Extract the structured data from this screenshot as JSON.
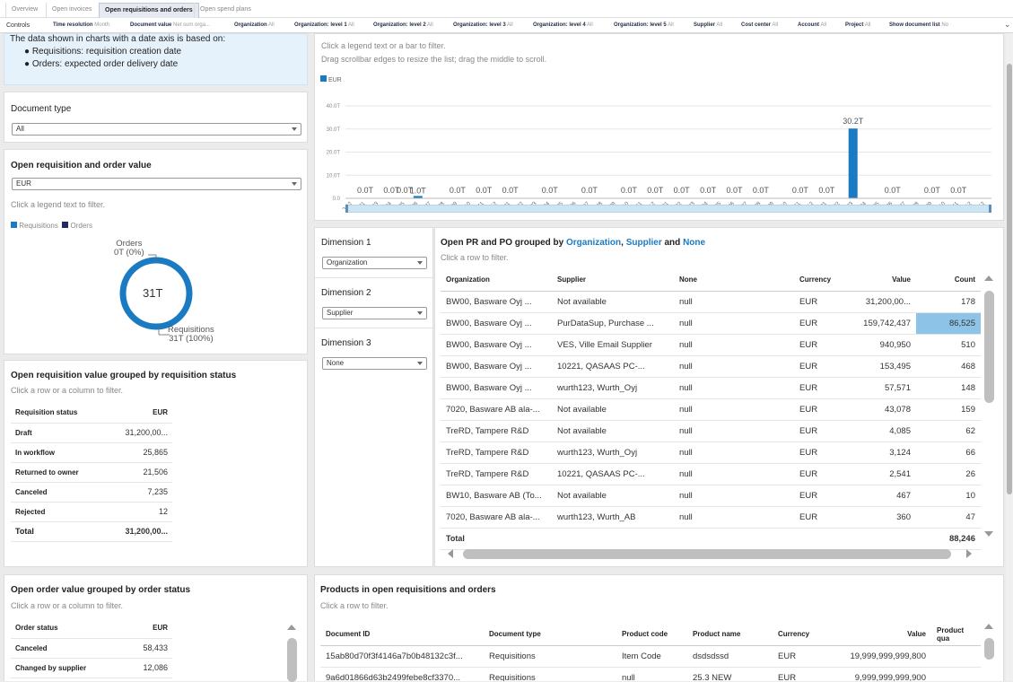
{
  "tabs": [
    {
      "label": "Overview"
    },
    {
      "label": "Open invoices"
    },
    {
      "label": "Open requisitions and orders"
    },
    {
      "label": "Open spend plans"
    }
  ],
  "controls": {
    "label": "Controls",
    "items": [
      {
        "name": "Time resolution",
        "value": "Month"
      },
      {
        "name": "Document value",
        "value": "Net sum orga..."
      },
      {
        "name": "Organization",
        "value": "All"
      },
      {
        "name": "Organization: level 1",
        "value": "All"
      },
      {
        "name": "Organization: level 2",
        "value": "All"
      },
      {
        "name": "Organization: level 3",
        "value": "All"
      },
      {
        "name": "Organization: level 4",
        "value": "All"
      },
      {
        "name": "Organization: level 5",
        "value": "All"
      },
      {
        "name": "Supplier",
        "value": "All"
      },
      {
        "name": "Cost center",
        "value": "All"
      },
      {
        "name": "Account",
        "value": "All"
      },
      {
        "name": "Project",
        "value": "All"
      },
      {
        "name": "Show document list",
        "value": "No"
      }
    ]
  },
  "info": {
    "line1": "The data shown in charts with a date axis is based on:",
    "bullet1": "Requisitions: requisition creation date",
    "bullet2": "Orders: expected order delivery date"
  },
  "doc_type": {
    "title": "Document type",
    "value": "All"
  },
  "donut": {
    "title": "Open requisition and order value",
    "currency": "EUR",
    "hint": "Click a legend text to filter.",
    "legend": [
      "Requisitions",
      "Orders"
    ],
    "center": "31T",
    "orders_label": "Orders",
    "orders_value": "0T (0%)",
    "req_label": "Requisitions",
    "req_value": "31T (100%)",
    "colors": {
      "requisitions": "#1a7bc2",
      "orders": "#1f2a5e"
    }
  },
  "req_status": {
    "title": "Open requisition value grouped by requisition status",
    "hint": "Click a row or a column to filter.",
    "col1": "Requisition status",
    "col2": "EUR",
    "rows": [
      {
        "label": "Draft",
        "value": "31,200,00..."
      },
      {
        "label": "In workflow",
        "value": "25,865"
      },
      {
        "label": "Returned to owner",
        "value": "21,506"
      },
      {
        "label": "Canceled",
        "value": "7,235"
      },
      {
        "label": "Rejected",
        "value": "12"
      }
    ],
    "total_label": "Total",
    "total_value": "31,200,00..."
  },
  "order_status": {
    "title": "Open order value grouped by order status",
    "hint": "Click a row or a column to filter.",
    "col1": "Order status",
    "col2": "EUR",
    "rows": [
      {
        "label": "Canceled",
        "value": "58,433"
      },
      {
        "label": "Changed by supplier",
        "value": "12,086"
      }
    ]
  },
  "bar_panel": {
    "hint1": "Click a legend text or a bar to filter.",
    "hint2": "Drag scrollbar edges to resize the list; drag the middle to scroll.",
    "legend": "EUR"
  },
  "chart_data": {
    "type": "bar",
    "series": [
      {
        "name": "EUR",
        "values": [
          0,
          0,
          0,
          1,
          0,
          0,
          0,
          0,
          0,
          0,
          0,
          0,
          0,
          0,
          0,
          0,
          0,
          0,
          0,
          0,
          0,
          0,
          30.2,
          0,
          0,
          0
        ]
      }
    ],
    "categories": [
      "2020-12",
      "2022-01",
      "2022-03",
      "2022-04",
      "2022-05",
      "2022-06",
      "2022-07",
      "2022-08",
      "2022-09",
      "2022-10",
      "2022-11",
      "2022-12",
      "2023-01",
      "2023-02",
      "2023-03",
      "2023-04",
      "2023-05",
      "2023-06",
      "2023-07",
      "2023-08",
      "2023-09",
      "2023-10",
      "2023-11",
      "2023-12",
      "2024-01",
      "2024-02",
      "2024-03",
      "2024-04",
      "2024-05",
      "2024-06",
      "2024-07",
      "2024-08",
      "2024-09",
      "2024-10",
      "2024-11",
      "2024-12",
      "2025-01",
      "2025-02",
      "2025-03",
      "2025-04",
      "2025-05",
      "2025-06",
      "2025-07",
      "2025-08",
      "2025-09",
      "2025-10",
      "2025-11",
      "2025-12",
      "2033-12"
    ],
    "bar_values": [
      0,
      0,
      0,
      0,
      0,
      1.0,
      0,
      0,
      0,
      0,
      0,
      0,
      0,
      0,
      0,
      0,
      0,
      0,
      0,
      0,
      0,
      0,
      0,
      0,
      0,
      0,
      0,
      0,
      0,
      0,
      0,
      0,
      0,
      0,
      0,
      0,
      0,
      0,
      30.2,
      0,
      0,
      0,
      0,
      0,
      0,
      0,
      0,
      0,
      0
    ],
    "value_labels": [
      {
        "i": 1,
        "t": "0.0T"
      },
      {
        "i": 3,
        "t": "0.0T"
      },
      {
        "i": 4,
        "t": "0.0T"
      },
      {
        "i": 5,
        "t": "1.0T"
      },
      {
        "i": 8,
        "t": "0.0T"
      },
      {
        "i": 10,
        "t": "0.0T"
      },
      {
        "i": 12,
        "t": "0.0T"
      },
      {
        "i": 15,
        "t": "0.0T"
      },
      {
        "i": 18,
        "t": "0.0T"
      },
      {
        "i": 21,
        "t": "0.0T"
      },
      {
        "i": 23,
        "t": "0.0T"
      },
      {
        "i": 25,
        "t": "0.0T"
      },
      {
        "i": 27,
        "t": "0.0T"
      },
      {
        "i": 29,
        "t": "0.0T"
      },
      {
        "i": 31,
        "t": "0.0T"
      },
      {
        "i": 34,
        "t": "0.0T"
      },
      {
        "i": 36,
        "t": "0.0T"
      },
      {
        "i": 38,
        "t": "30.2T"
      },
      {
        "i": 41,
        "t": "0.0T"
      },
      {
        "i": 44,
        "t": "0.0T"
      },
      {
        "i": 46,
        "t": "0.0T"
      }
    ],
    "yticks": [
      "0.0",
      "10.0T",
      "20.0T",
      "30.0T",
      "40.0T"
    ],
    "ylim": [
      0,
      40
    ],
    "color": "#1a7bc2"
  },
  "dims": {
    "d1": "Dimension 1",
    "d1v": "Organization",
    "d2": "Dimension 2",
    "d2v": "Supplier",
    "d3": "Dimension 3",
    "d3v": "None"
  },
  "grid": {
    "title_pre": "Open PR and PO grouped by ",
    "t1": "Organization",
    "sep1": ", ",
    "t2": "Supplier",
    "sep2": " and ",
    "t3": "None",
    "hint": "Click a row to filter.",
    "headers": [
      "Organization",
      "Supplier",
      "None",
      "Currency",
      "Value",
      "Count"
    ],
    "rows": [
      [
        "BW00, Basware Oyj ...",
        "Not available",
        "null",
        "EUR",
        "31,200,00...",
        "178"
      ],
      [
        "BW00, Basware Oyj ...",
        "PurDataSup, Purchase ...",
        "null",
        "EUR",
        "159,742,437",
        "86,525"
      ],
      [
        "BW00, Basware Oyj ...",
        "VES, Ville Email Supplier",
        "null",
        "EUR",
        "940,950",
        "510"
      ],
      [
        "BW00, Basware Oyj ...",
        "10221, QASAAS PC-...",
        "null",
        "EUR",
        "153,495",
        "468"
      ],
      [
        "BW00, Basware Oyj ...",
        "wurth123, Wurth_Oyj",
        "null",
        "EUR",
        "57,571",
        "148"
      ],
      [
        "7020, Basware AB ala-...",
        "Not available",
        "null",
        "EUR",
        "43,078",
        "159"
      ],
      [
        "TreRD, Tampere R&D",
        "Not available",
        "null",
        "EUR",
        "4,085",
        "62"
      ],
      [
        "TreRD, Tampere R&D",
        "wurth123, Wurth_Oyj",
        "null",
        "EUR",
        "3,124",
        "66"
      ],
      [
        "TreRD, Tampere R&D",
        "10221, QASAAS PC-...",
        "null",
        "EUR",
        "2,541",
        "26"
      ],
      [
        "BW10, Basware AB (To...",
        "Not available",
        "null",
        "EUR",
        "467",
        "10"
      ],
      [
        "7020, Basware AB ala-...",
        "wurth123, Wurth_AB",
        "null",
        "EUR",
        "360",
        "47"
      ]
    ],
    "total_label": "Total",
    "total_value": "88,246"
  },
  "products": {
    "title": "Products in open requisitions and orders",
    "hint": "Click a row to filter.",
    "headers": [
      "Document ID",
      "Document type",
      "Product code",
      "Product name",
      "Currency",
      "Value",
      "Product qua"
    ],
    "rows": [
      [
        "15ab80d70f3f4146a7b0b48132c3f...",
        "Requisitions",
        "Item Code",
        "dsdsdssd",
        "EUR",
        "19,999,999,999,800",
        ""
      ],
      [
        "9a6d01866d63b2499febe8cf3370...",
        "Requisitions",
        "null",
        "25.3 NEW",
        "EUR",
        "9,999,999,999,900",
        ""
      ]
    ]
  }
}
